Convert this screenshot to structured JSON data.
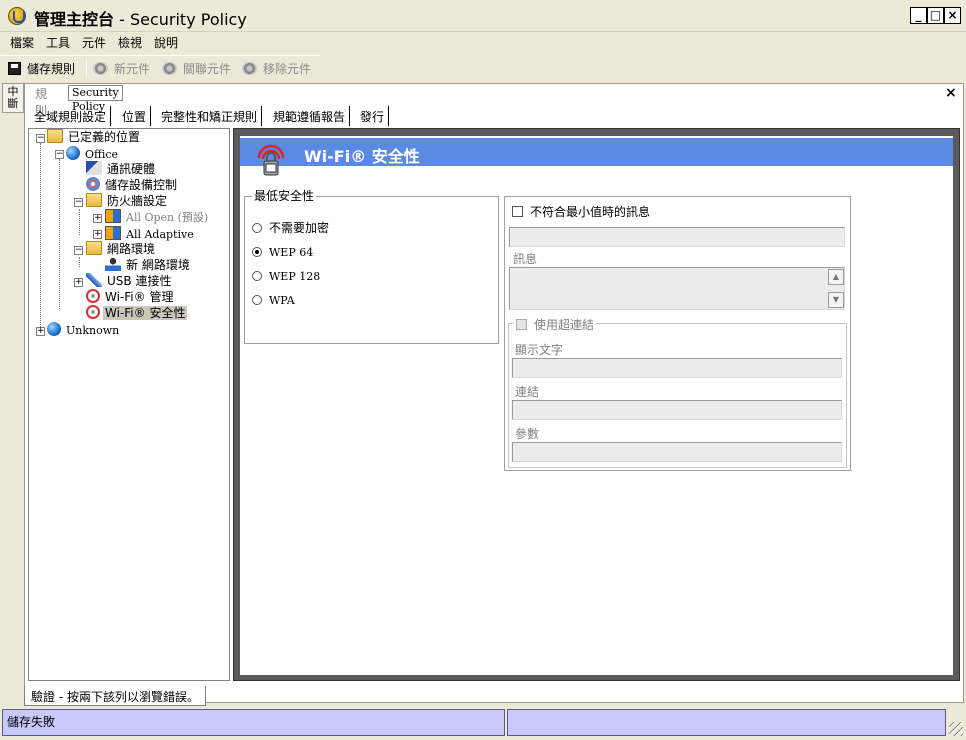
{
  "window": {
    "title_cjk": "管理主控台",
    "title_sep": " - ",
    "title_en": "Security Policy",
    "min_glyph": "_",
    "max_glyph": "□",
    "close_glyph": "×"
  },
  "menu": [
    "檔案",
    "工具",
    "元件",
    "檢視",
    "說明"
  ],
  "toolbar": {
    "save": "儲存規則",
    "new_component": "新元件",
    "link_component": "關聯元件",
    "remove_component": "移除元件"
  },
  "side_strip": "中斷",
  "doc": {
    "tab_rules": "規則",
    "tab_policy": "Security Policy",
    "close_glyph": "×"
  },
  "policy_tabs": [
    "全域規則設定",
    "位置",
    "完整性和矯正規則",
    "規範遵循報告",
    "發行"
  ],
  "tree": {
    "root": "已定義的位置",
    "office": "Office",
    "comm_hw": "通訊硬體",
    "storage_ctrl": "儲存設備控制",
    "firewall": "防火牆設定",
    "all_open": "All Open (預設)",
    "all_adaptive": "All Adaptive",
    "net_env": "網路環境",
    "new_net_env": "新 網路環境",
    "usb": "USB 連接性",
    "wifi_mgmt": "Wi-Fi® 管理",
    "wifi_sec": "Wi-Fi® 安全性",
    "unknown": "Unknown",
    "expand_glyph": "+",
    "collapse_glyph": "−"
  },
  "panel": {
    "title": "Wi-Fi® 安全性",
    "min_security_legend": "最低安全性",
    "options": [
      {
        "label": "不需要加密",
        "selected": false
      },
      {
        "label": "WEP 64",
        "selected": true
      },
      {
        "label": "WEP 128",
        "selected": false
      },
      {
        "label": "WPA",
        "selected": false
      }
    ],
    "msg_checkbox": "不符合最小值時的訊息",
    "message_label": "訊息",
    "hyperlink_checkbox": "使用超連結",
    "display_text_label": "顯示文字",
    "link_label": "連結",
    "params_label": "參數",
    "scroll_up": "▲",
    "scroll_down": "▼"
  },
  "bottom_tab": "驗證 - 按兩下該列以瀏覽錯誤。",
  "status": {
    "left": "儲存失敗",
    "right": ""
  },
  "colors": {
    "panel_header": "#5b8ae3",
    "status_bar": "#c7c9fa",
    "window_bg": "#ece9d8"
  }
}
